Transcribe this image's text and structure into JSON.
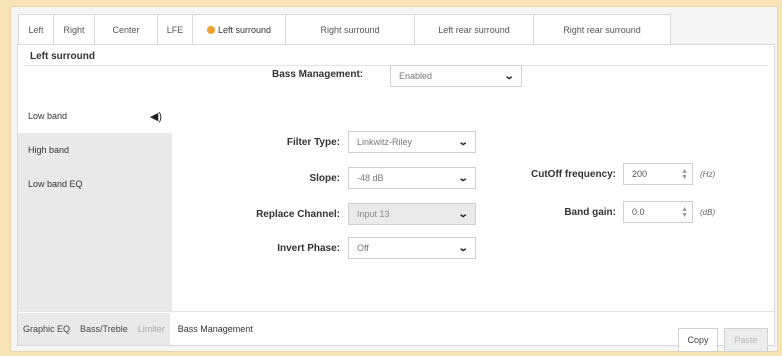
{
  "tabs": [
    {
      "label": "Left"
    },
    {
      "label": "Right"
    },
    {
      "label": "Center"
    },
    {
      "label": "LFE"
    },
    {
      "label": "Left surround"
    },
    {
      "label": "Right surround"
    },
    {
      "label": "Left rear surround"
    },
    {
      "label": "Right rear surround"
    }
  ],
  "channel_title": "Left surround",
  "bass_management": {
    "label": "Bass Management:",
    "value": "Enabled"
  },
  "bands": [
    {
      "label": "Low band"
    },
    {
      "label": "High band"
    },
    {
      "label": "Low band EQ"
    }
  ],
  "filter_type": {
    "label": "Filter Type:",
    "value": "Linkwitz-Riley"
  },
  "slope": {
    "label": "Slope:",
    "value": "-48 dB"
  },
  "replace_channel": {
    "label": "Replace Channel:",
    "value": "Input 13"
  },
  "invert_phase": {
    "label": "Invert Phase:",
    "value": "Off"
  },
  "cutoff": {
    "label": "CutOff frequency:",
    "value": "200",
    "unit": "(Hz)"
  },
  "band_gain": {
    "label": "Band gain:",
    "value": "0.0",
    "unit": "(dB)"
  },
  "bottom_tabs": [
    {
      "label": "Graphic EQ"
    },
    {
      "label": "Bass/Treble"
    },
    {
      "label": "Limiter"
    },
    {
      "label": "Bass Management"
    }
  ],
  "buttons": {
    "copy": "Copy",
    "paste": "Paste"
  },
  "colors": {
    "background": "#f8e3b6",
    "active_dot": "#f0a030"
  }
}
